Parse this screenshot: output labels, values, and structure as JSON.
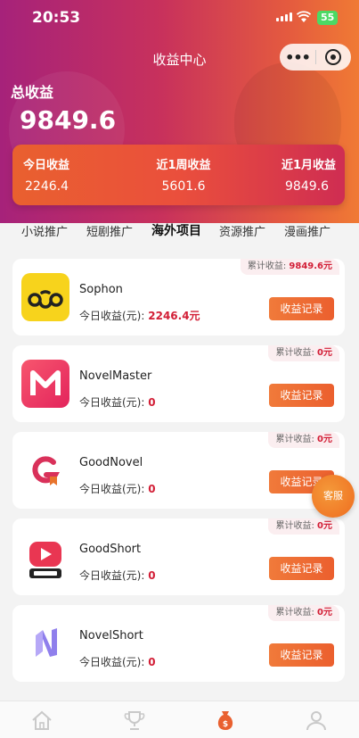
{
  "status_bar": {
    "time": "20:53",
    "battery": "55"
  },
  "nav": {
    "title": "收益中心",
    "more_icon": "more-dots-icon",
    "close_icon": "target-icon"
  },
  "total": {
    "label": "总收益",
    "value": "9849.6"
  },
  "summary": [
    {
      "label": "今日收益",
      "value": "2246.4"
    },
    {
      "label": "近1周收益",
      "value": "5601.6"
    },
    {
      "label": "近1月收益",
      "value": "9849.6"
    }
  ],
  "tabs": [
    {
      "label": "小说推广",
      "active": false
    },
    {
      "label": "短剧推广",
      "active": false
    },
    {
      "label": "海外项目",
      "active": true
    },
    {
      "label": "资源推广",
      "active": false
    },
    {
      "label": "漫画推广",
      "active": false
    }
  ],
  "cards": [
    {
      "name": "Sophon",
      "today_label": "今日收益(元):",
      "today_value": "2246.4元",
      "total_label": "累计收益:",
      "total_value": "9849.6元",
      "button": "收益记录",
      "logo_color": "#f7d31c"
    },
    {
      "name": "NovelMaster",
      "today_label": "今日收益(元):",
      "today_value": "0",
      "total_label": "累计收益:",
      "total_value": "0元",
      "button": "收益记录",
      "logo_color": "#ef3f6a"
    },
    {
      "name": "GoodNovel",
      "today_label": "今日收益(元):",
      "today_value": "0",
      "total_label": "累计收益:",
      "total_value": "0元",
      "button": "收益记录",
      "logo_color": "#d9315a"
    },
    {
      "name": "GoodShort",
      "today_label": "今日收益(元):",
      "today_value": "0",
      "total_label": "累计收益:",
      "total_value": "0元",
      "button": "收益记录",
      "logo_color": "#e93652"
    },
    {
      "name": "NovelShort",
      "today_label": "今日收益(元):",
      "today_value": "0",
      "total_label": "累计收益:",
      "total_value": "0元",
      "button": "收益记录",
      "logo_color": "#9b8cf0"
    }
  ],
  "float_button": {
    "label": "客服"
  },
  "tabbar": [
    {
      "icon": "home-icon",
      "active": false
    },
    {
      "icon": "trophy-icon",
      "active": false
    },
    {
      "icon": "money-bag-icon",
      "active": true
    },
    {
      "icon": "user-icon",
      "active": false
    }
  ],
  "colors": {
    "accent": "#e9602f",
    "highlight_red": "#d21e36"
  }
}
